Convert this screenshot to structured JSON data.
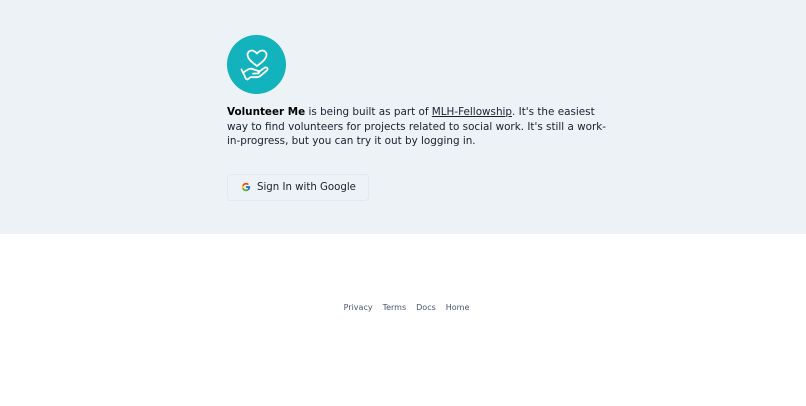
{
  "hero": {
    "brand": "Volunteer Me",
    "intro_part1": " is being built as part of ",
    "fellowship_link": "MLH-Fellowship",
    "intro_part2": ". It's the easiest way to find volunteers for projects related to social work. It's still a work-in-progress, but you can try it out by logging in.",
    "signin_label": "Sign In with Google",
    "logo_color": "#12b3bd",
    "background_color": "#edf2f7"
  },
  "footer": {
    "links": [
      "Privacy",
      "Terms",
      "Docs",
      "Home"
    ]
  }
}
